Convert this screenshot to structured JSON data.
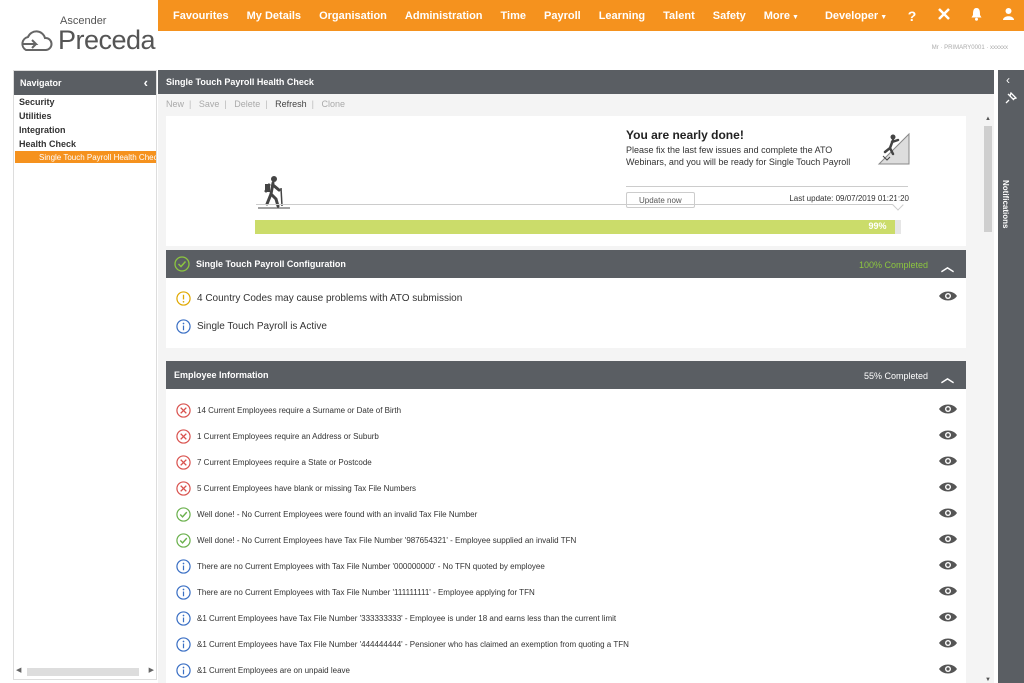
{
  "brand": {
    "ascender": "Ascender",
    "preceda": "Preceda"
  },
  "topnav": {
    "items": [
      "Favourites",
      "My Details",
      "Organisation",
      "Administration",
      "Time",
      "Payroll",
      "Learning",
      "Talent",
      "Safety",
      "More",
      "Developer"
    ],
    "icons": [
      "help-icon",
      "tools-icon",
      "bell-icon",
      "user-icon"
    ],
    "help_glyph": "?"
  },
  "user": {
    "info": "Mr · PRIMARY0001 · xxxxxx"
  },
  "sidebar": {
    "title": "Navigator",
    "items": [
      "Security",
      "Utilities",
      "Integration",
      "Health Check"
    ],
    "subitem": "Single Touch Payroll Health Check"
  },
  "page": {
    "title": "Single Touch Payroll Health Check"
  },
  "toolbar": {
    "new": "New",
    "save": "Save",
    "delete": "Delete",
    "refresh": "Refresh",
    "clone": "Clone"
  },
  "progress": {
    "heading": "You are nearly done!",
    "message": "Please fix the last few issues and complete the ATO Webinars, and you will be ready for Single Touch Payroll",
    "update_button": "Update now",
    "last_update": "Last update: 09/07/2019 01:21:20",
    "percent_label": "99%",
    "percent": 0.99
  },
  "sections": [
    {
      "title": "Single Touch Payroll Configuration",
      "status": "100% Completed",
      "status_color": "#8cc63f",
      "rows": [
        {
          "type": "warning",
          "text": "4 Country Codes may cause problems with ATO submission"
        },
        {
          "type": "info",
          "text": "Single Touch Payroll is Active"
        }
      ]
    },
    {
      "title": "Employee Information",
      "status": "55% Completed",
      "status_color": "#ffffff",
      "rows": [
        {
          "type": "error",
          "text": "14 Current Employees require a Surname or Date of Birth"
        },
        {
          "type": "error",
          "text": "1 Current Employees require an Address or Suburb"
        },
        {
          "type": "error",
          "text": "7 Current Employees require a State or Postcode"
        },
        {
          "type": "error",
          "text": "5 Current Employees have blank or missing Tax File Numbers"
        },
        {
          "type": "success",
          "text": "Well done! - No Current Employees were found with an invalid Tax File Number"
        },
        {
          "type": "success",
          "text": "Well done! - No Current Employees have Tax File Number '987654321' - Employee supplied an invalid TFN"
        },
        {
          "type": "info",
          "text": "There are no Current Employees with Tax File Number '000000000' - No TFN quoted by employee"
        },
        {
          "type": "info",
          "text": "There are no Current Employees with Tax File Number '111111111' - Employee applying for TFN"
        },
        {
          "type": "info",
          "text": "&1 Current Employees have Tax File Number '333333333' - Employee is under 18 and earns less than the current limit"
        },
        {
          "type": "info",
          "text": "&1 Current Employees have Tax File Number '444444444' - Pensioner who has claimed an exemption from quoting a TFN"
        },
        {
          "type": "info",
          "text": "&1 Current Employees are on unpaid leave"
        }
      ]
    }
  ],
  "notifications": {
    "label": "Notifications"
  },
  "colors": {
    "accent": "#f5921e",
    "header": "#5a5e63",
    "progress": "#cbdc6a",
    "error": "#d9534f",
    "success": "#6ab04c",
    "info": "#3a6fc4",
    "warning": "#e0a800"
  }
}
